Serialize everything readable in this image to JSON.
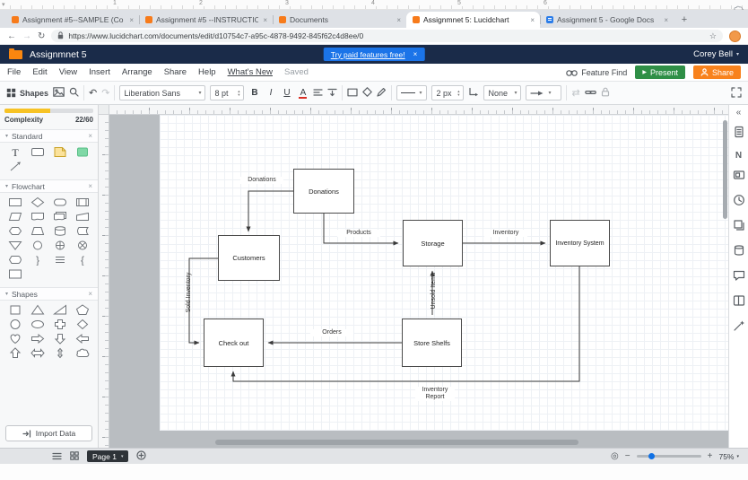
{
  "glyphs": {
    "close": "×",
    "caret": "▾",
    "plus": "+",
    "minus": "−",
    "back": "←",
    "forward": "→",
    "reload": "↻",
    "star": "☆",
    "undo": "↶",
    "redo": "↷",
    "swap": "⇄",
    "collapse": "«",
    "fit": "◎",
    "play": "▶"
  },
  "doc_ruler": {
    "numbers": [
      "1",
      "2",
      "3",
      "4",
      "5",
      "6"
    ]
  },
  "browser": {
    "tabs": [
      {
        "label": "Assignment #5--SAMPLE (Co"
      },
      {
        "label": "Assignment #5 --INSTRUCTIO"
      },
      {
        "label": "Documents"
      },
      {
        "label": "Assignmnet 5: Lucidchart"
      },
      {
        "label": "Assignment 5 - Google Docs"
      }
    ],
    "url": "https://www.lucidchart.com/documents/edit/d10754c7-a95c-4878-9492-845f62c4d8ee/0"
  },
  "header": {
    "title": "Assignmnet 5",
    "banner_text": "Try paid features free!",
    "user": "Corey Bell"
  },
  "menubar": {
    "items": [
      "File",
      "Edit",
      "View",
      "Insert",
      "Arrange",
      "Share",
      "Help"
    ],
    "whats_new": "What's New",
    "saved": "Saved",
    "feature_find": "Feature Find",
    "present": "Present",
    "share": "Share"
  },
  "toolbar": {
    "shapes_label": "Shapes",
    "font": "Liberation Sans",
    "font_size": "8 pt",
    "bold": "B",
    "italic": "I",
    "underline": "U",
    "text_color": "A",
    "line_width": "2 px",
    "arrow_start": "None"
  },
  "sidebar": {
    "complexity_label": "Complexity",
    "complexity_value": "22/60",
    "standard_label": "Standard",
    "flowchart_label": "Flowchart",
    "shapes_label": "Shapes",
    "import_label": "Import Data"
  },
  "canvas": {
    "nodes": [
      {
        "label": "Donations"
      },
      {
        "label": "Customers"
      },
      {
        "label": "Storage"
      },
      {
        "label": "Inventory System"
      },
      {
        "label": "Check out"
      },
      {
        "label": "Store Shelfs"
      }
    ],
    "edges": [
      {
        "label": "Donations"
      },
      {
        "label": "Products"
      },
      {
        "label": "Inventory"
      },
      {
        "label": "Sold Inventory"
      },
      {
        "label": "Orders"
      },
      {
        "label": "Unsold Items"
      },
      {
        "label": "Inventory Report"
      }
    ]
  },
  "statusbar": {
    "page": "Page 1",
    "zoom": "75%"
  }
}
